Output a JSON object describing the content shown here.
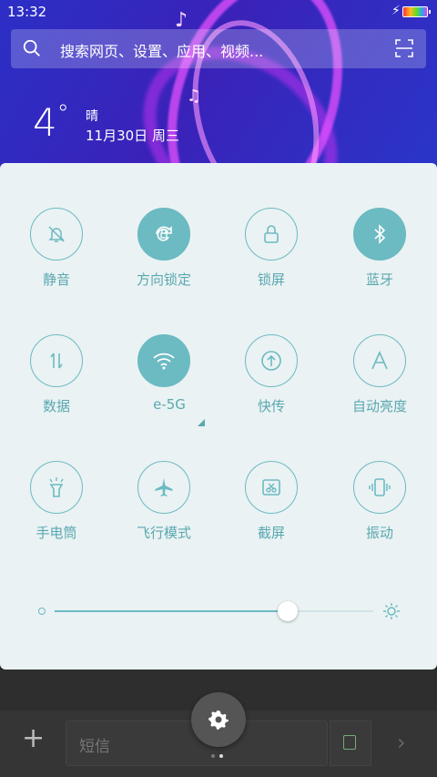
{
  "status": {
    "time": "13:32"
  },
  "search": {
    "placeholder": "搜索网页、设置、应用、视频..."
  },
  "weather": {
    "temperature": "4",
    "degree": "°",
    "condition": "晴",
    "date": "11月30日 周三"
  },
  "tiles": [
    {
      "label": "静音",
      "icon": "bell-off-icon",
      "active": false
    },
    {
      "label": "方向锁定",
      "icon": "rotation-lock-icon",
      "active": true
    },
    {
      "label": "锁屏",
      "icon": "lock-icon",
      "active": false
    },
    {
      "label": "蓝牙",
      "icon": "bluetooth-icon",
      "active": true
    },
    {
      "label": "数据",
      "icon": "mobile-data-icon",
      "active": false
    },
    {
      "label": "e-5G",
      "icon": "wifi-icon",
      "active": true
    },
    {
      "label": "快传",
      "icon": "quick-transfer-icon",
      "active": false
    },
    {
      "label": "自动亮度",
      "icon": "auto-brightness-icon",
      "active": false
    },
    {
      "label": "手电筒",
      "icon": "flashlight-icon",
      "active": false
    },
    {
      "label": "飞行模式",
      "icon": "airplane-icon",
      "active": false
    },
    {
      "label": "截屏",
      "icon": "screenshot-icon",
      "active": false
    },
    {
      "label": "振动",
      "icon": "vibrate-icon",
      "active": false
    }
  ],
  "brightness": {
    "level": 0.73
  },
  "messaging": {
    "placeholder": "短信"
  },
  "pager": {
    "pages": 2,
    "current": 1
  },
  "colors": {
    "accent": "#6cbac2",
    "panel": "#eaf2f3"
  }
}
